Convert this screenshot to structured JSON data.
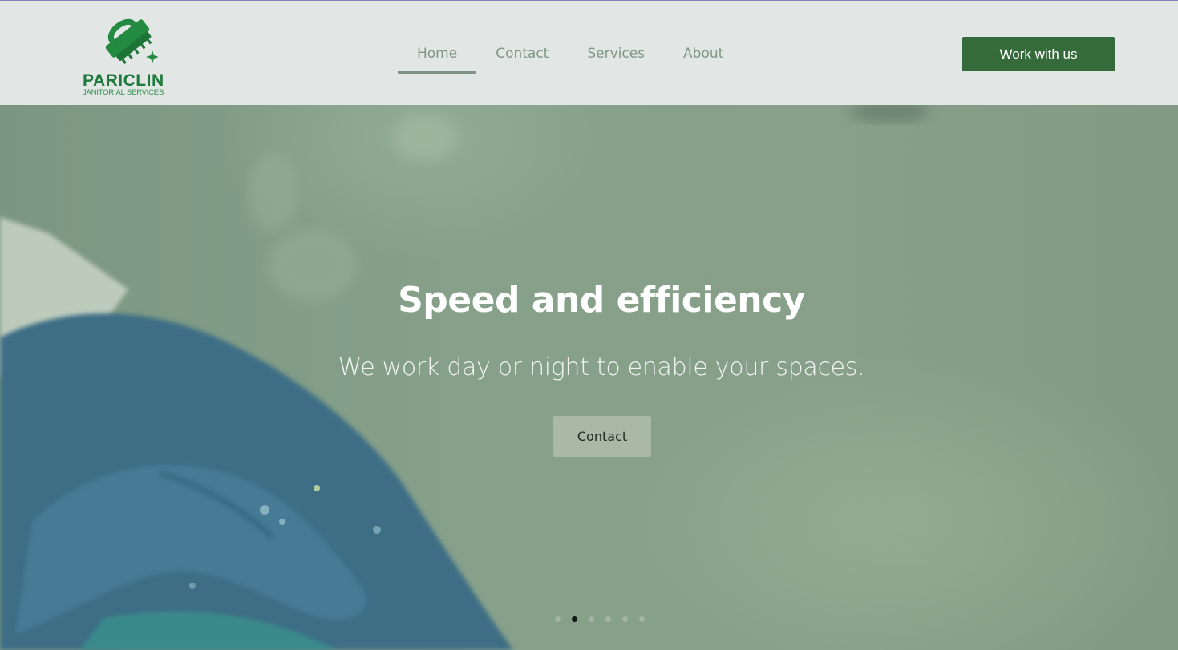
{
  "brand": {
    "name": "PARICLIN",
    "tagline": "JANITORIAL SERVICES",
    "logo_icon": "scrub-brush-icon",
    "color": "#1e7a3c"
  },
  "nav": {
    "items": [
      {
        "label": "Home",
        "active": true
      },
      {
        "label": "Contact",
        "active": false
      },
      {
        "label": "Services",
        "active": false
      },
      {
        "label": "About",
        "active": false
      }
    ]
  },
  "header": {
    "cta_label": "Work with us",
    "cta_color": "#356a3a"
  },
  "hero": {
    "title": "Speed and efficiency",
    "subtitle": "We work day or night to enable your spaces.",
    "button_label": "Contact",
    "slides_count": 6,
    "active_slide": 2,
    "overlay_color": "#869f88"
  }
}
